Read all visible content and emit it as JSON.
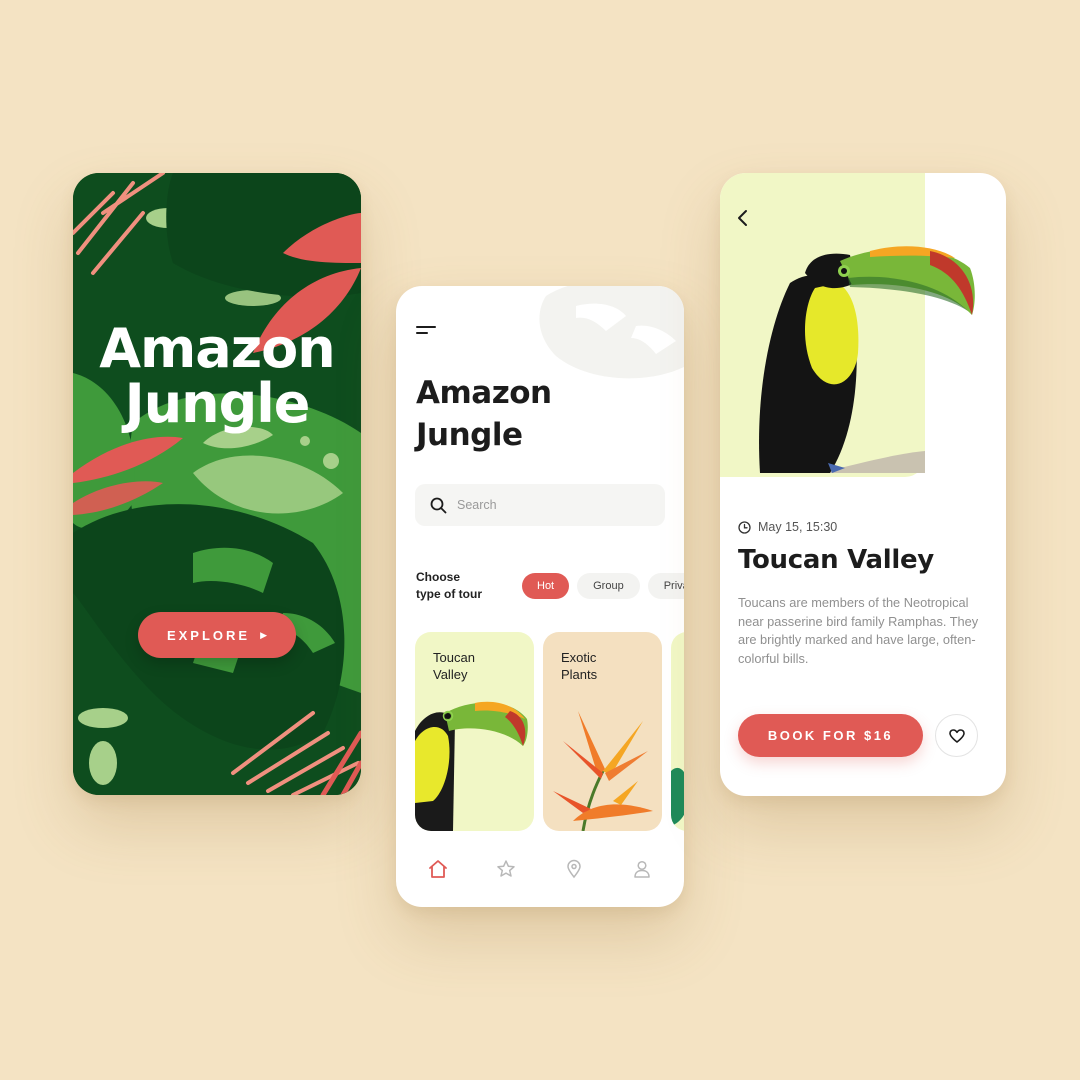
{
  "colors": {
    "background": "#f4e3c3",
    "accent": "#e05a55",
    "jungle_dark": "#0e4d1e",
    "jungle_green": "#3f9a3b",
    "leaf_light": "#a7d08a",
    "card_lime": "#f1f7c6",
    "card_sand": "#f4e0c0"
  },
  "splash": {
    "title_line1": "Amazon",
    "title_line2": "Jungle",
    "explore_label": "EXPLORE",
    "explore_icon": "play-arrow-icon"
  },
  "home": {
    "menu_icon": "hamburger-menu-icon",
    "title_line1": "Amazon",
    "title_line2": "Jungle",
    "search": {
      "placeholder": "Search",
      "value": "",
      "icon": "search-icon"
    },
    "tour_label_line1": "Choose",
    "tour_label_line2": "type of tour",
    "chips": [
      {
        "label": "Hot",
        "active": true
      },
      {
        "label": "Group",
        "active": false
      },
      {
        "label": "Private",
        "active": false
      }
    ],
    "cards": [
      {
        "title_line1": "Toucan",
        "title_line2": "Valley",
        "image": "toucan"
      },
      {
        "title_line1": "Exotic",
        "title_line2": "Plants",
        "image": "bird-of-paradise-flower"
      },
      {
        "title_line1": "",
        "title_line2": "",
        "image": "leaf"
      }
    ],
    "nav": [
      {
        "icon": "home-icon",
        "active": true
      },
      {
        "icon": "star-icon",
        "active": false
      },
      {
        "icon": "location-pin-icon",
        "active": false
      },
      {
        "icon": "user-icon",
        "active": false
      }
    ]
  },
  "detail": {
    "back_icon": "chevron-left-icon",
    "date": "May 15, 15:30",
    "date_icon": "clock-icon",
    "title": "Toucan Valley",
    "description": "Toucans are members of the Neotropical near passerine bird family Ramphas. They are brightly marked and have large, often-colorful bills.",
    "book_label": "BOOK FOR $16",
    "favorite_icon": "heart-icon"
  }
}
